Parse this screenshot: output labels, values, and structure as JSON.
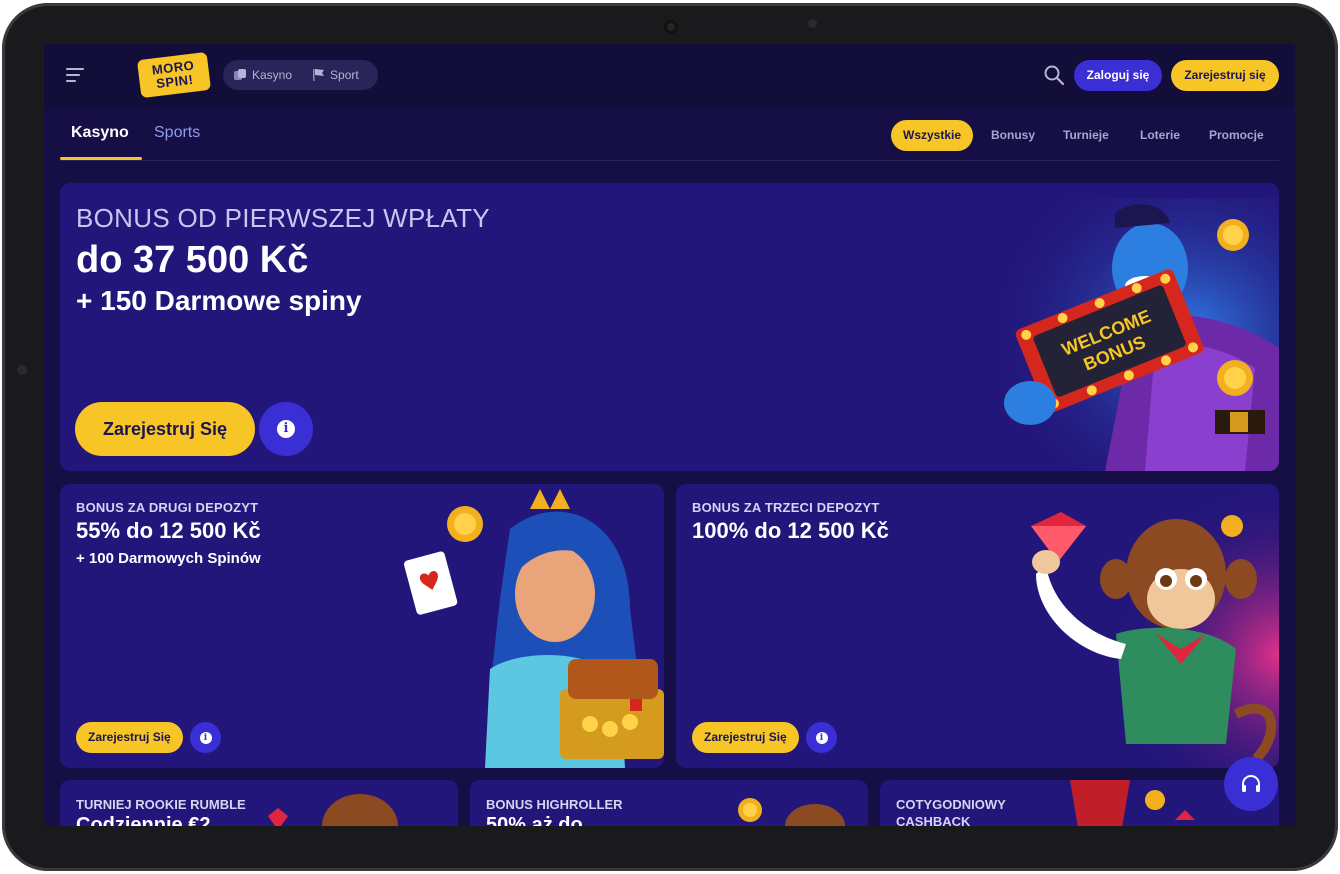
{
  "header": {
    "logo_text_line1": "MORO",
    "logo_text_line2": "SPIN!",
    "mode_switch": [
      {
        "label": "Kasyno",
        "icon": "casino-icon"
      },
      {
        "label": "Sport",
        "icon": "sport-flag-icon"
      }
    ],
    "login_label": "Zaloguj się",
    "register_label": "Zarejestruj się"
  },
  "tabs": {
    "main": [
      {
        "label": "Kasyno",
        "active": true
      },
      {
        "label": "Sports",
        "active": false
      }
    ],
    "filters": [
      {
        "label": "Wszystkie",
        "active": true
      },
      {
        "label": "Bonusy",
        "active": false
      },
      {
        "label": "Turnieje",
        "active": false
      },
      {
        "label": "Loterie",
        "active": false
      },
      {
        "label": "Promocje",
        "active": false
      }
    ]
  },
  "hero": {
    "title": "BONUS OD PIERWSZEJ WPŁATY",
    "amount": "do 37 500 Kč",
    "spins": "+ 150 Darmowe spiny",
    "cta": "Zarejestruj Się",
    "sign_line1": "WELCOME",
    "sign_line2": "BONUS"
  },
  "cards": [
    {
      "title": "BONUS ZA DRUGI DEPOZYT",
      "amount": "55% do 12 500 Kč",
      "sub": "+ 100 Darmowych Spinów",
      "cta": "Zarejestruj Się"
    },
    {
      "title": "BONUS ZA TRZECI DEPOZYT",
      "amount": "100% do 12 500 Kč",
      "sub": "",
      "cta": "Zarejestruj Się"
    }
  ],
  "small_cards": [
    {
      "title": "TURNIEJ ROOKIE RUMBLE",
      "amount": "Codziennie €2"
    },
    {
      "title": "BONUS HIGHROLLER",
      "amount": "50% aż do"
    },
    {
      "title": "COTYGODNIOWY CASHBACK",
      "amount": ""
    }
  ],
  "colors": {
    "background": "#150f45",
    "card": "#23167a",
    "accent_yellow": "#f7c525",
    "accent_blue": "#3a2fd4"
  }
}
